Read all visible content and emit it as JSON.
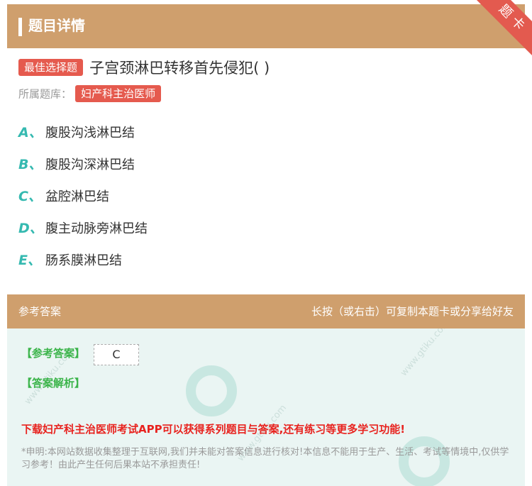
{
  "header": {
    "title": "题目详情",
    "ribbon": "题卡"
  },
  "question": {
    "type_badge": "最佳选择题",
    "text": "子宫颈淋巴转移首先侵犯( )"
  },
  "bank": {
    "label": "所属题库：",
    "name": "妇产科主治医师"
  },
  "options": [
    {
      "letter": "A、",
      "text": "腹股沟浅淋巴结"
    },
    {
      "letter": "B、",
      "text": "腹股沟深淋巴结"
    },
    {
      "letter": "C、",
      "text": "盆腔淋巴结"
    },
    {
      "letter": "D、",
      "text": "腹主动脉旁淋巴结"
    },
    {
      "letter": "E、",
      "text": "肠系膜淋巴结"
    }
  ],
  "answer_section": {
    "title": "参考答案",
    "hint": "长按（或右击）可复制本题卡或分享给好友",
    "answer_label": "【参考答案】",
    "answer_value": "C",
    "analysis_label": "【答案解析】",
    "promo": "下载妇产科主治医师考试APP可以获得系列题目与答案,还有练习等更多学习功能!",
    "disclaimer": "*申明:本网站数据收集整理于互联网,我们并未能对答案信息进行核对!本信息不能用于生产、生活、考试等情境中,仅供学习参考！由此产生任何后果本站不承担责任!"
  },
  "colors": {
    "header_bg": "#cf9f6d",
    "badge": "#e55a4e",
    "option_letter": "#35b9b0",
    "answer_green": "#3bb44a",
    "promo_red": "#e8231f"
  }
}
